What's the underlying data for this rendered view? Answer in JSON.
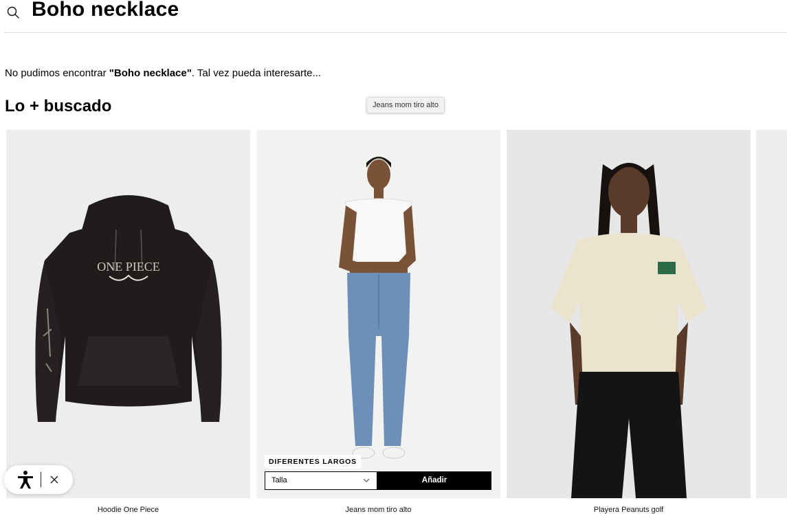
{
  "search": {
    "query": "Boho necklace"
  },
  "message": {
    "prefix": "No pudimos encontrar ",
    "term": "\"Boho necklace\"",
    "suffix": ". Tal vez pueda interesarte..."
  },
  "section": {
    "title": "Lo + buscado"
  },
  "tooltip": {
    "text": "Jeans mom tiro alto"
  },
  "products": [
    {
      "name": "Hoodie One Piece",
      "print_text": "ONE PIECE"
    },
    {
      "name": "Jeans mom tiro alto",
      "badge": "DIFERENTES LARGOS",
      "size_placeholder": "Talla",
      "add_label": "Añadir"
    },
    {
      "name": "Playera Peanuts golf"
    }
  ],
  "accessibility_widget": {
    "icon": "accessibility-icon",
    "close_icon": "close-icon"
  },
  "colors": {
    "add_button": "#000000",
    "divider": "#dcdcdc",
    "hoodie": "#1f1c1b",
    "jeans": "#6d8fb8",
    "tee": "#ece3cf"
  }
}
